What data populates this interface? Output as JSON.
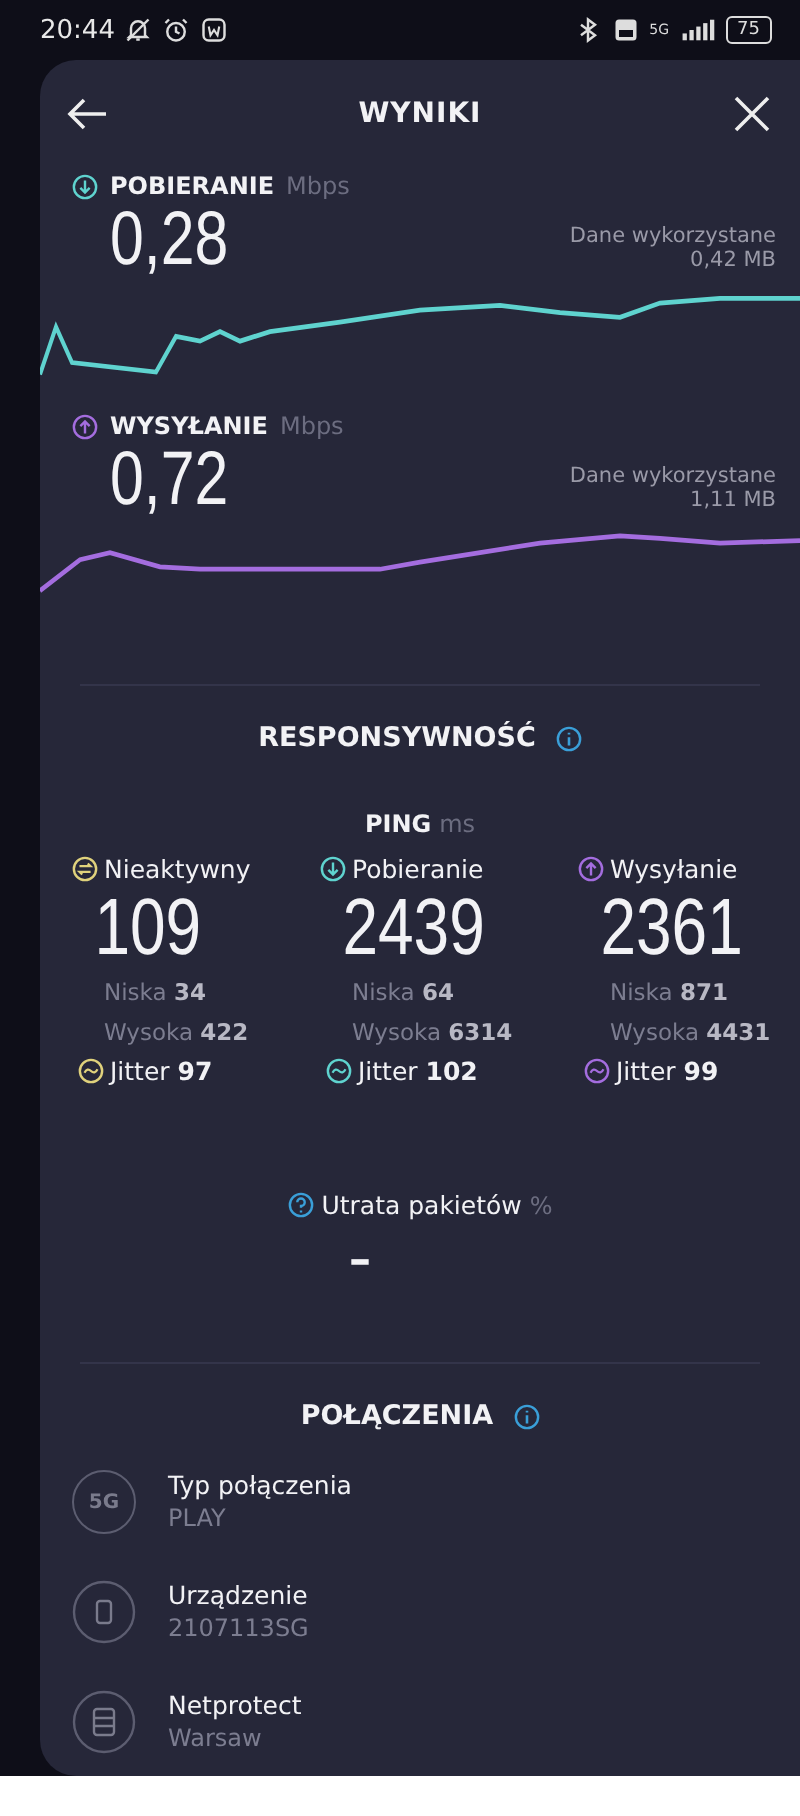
{
  "status_bar": {
    "time": "20:44",
    "network": "5G",
    "battery": "75"
  },
  "header": {
    "title": "WYNIKI"
  },
  "speeds": [
    {
      "kind": "download",
      "label": "POBIERANIE",
      "unit": "Mbps",
      "value": "0,28",
      "data_label": "Dane wykorzystane",
      "data_value": "0,42 MB",
      "color": "#5fd3cf"
    },
    {
      "kind": "upload",
      "label": "WYSYŁANIE",
      "unit": "Mbps",
      "value": "0,72",
      "data_label": "Dane wykorzystane",
      "data_value": "1,11 MB",
      "color": "#a46ddf"
    }
  ],
  "responsiveness": {
    "title": "RESPONSYWNOŚĆ",
    "ping_label": "PING",
    "ping_unit": "ms",
    "columns": [
      {
        "kind": "idle",
        "label": "Nieaktywny",
        "value": "109",
        "low_label": "Niska",
        "low": "34",
        "high_label": "Wysoka",
        "high": "422",
        "jitter_label": "Jitter",
        "jitter": "97",
        "color": "#e0d27c"
      },
      {
        "kind": "download",
        "label": "Pobieranie",
        "value": "2439",
        "low_label": "Niska",
        "low": "64",
        "high_label": "Wysoka",
        "high": "6314",
        "jitter_label": "Jitter",
        "jitter": "102",
        "color": "#5fd3cf"
      },
      {
        "kind": "upload",
        "label": "Wysyłanie",
        "value": "2361",
        "low_label": "Niska",
        "low": "871",
        "high_label": "Wysoka",
        "high": "4431",
        "jitter_label": "Jitter",
        "jitter": "99",
        "color": "#a46ddf"
      }
    ],
    "packet_loss": {
      "label": "Utrata pakietów",
      "unit": "%",
      "value": "–"
    }
  },
  "connections": {
    "title": "POŁĄCZENIA",
    "items": [
      {
        "kind": "network",
        "title": "Typ połączenia",
        "value": "PLAY",
        "badge": "5G"
      },
      {
        "kind": "device",
        "title": "Urządzenie",
        "value": "2107113SG"
      },
      {
        "kind": "server",
        "title": "Netprotect",
        "value": "Warsaw"
      }
    ]
  }
}
